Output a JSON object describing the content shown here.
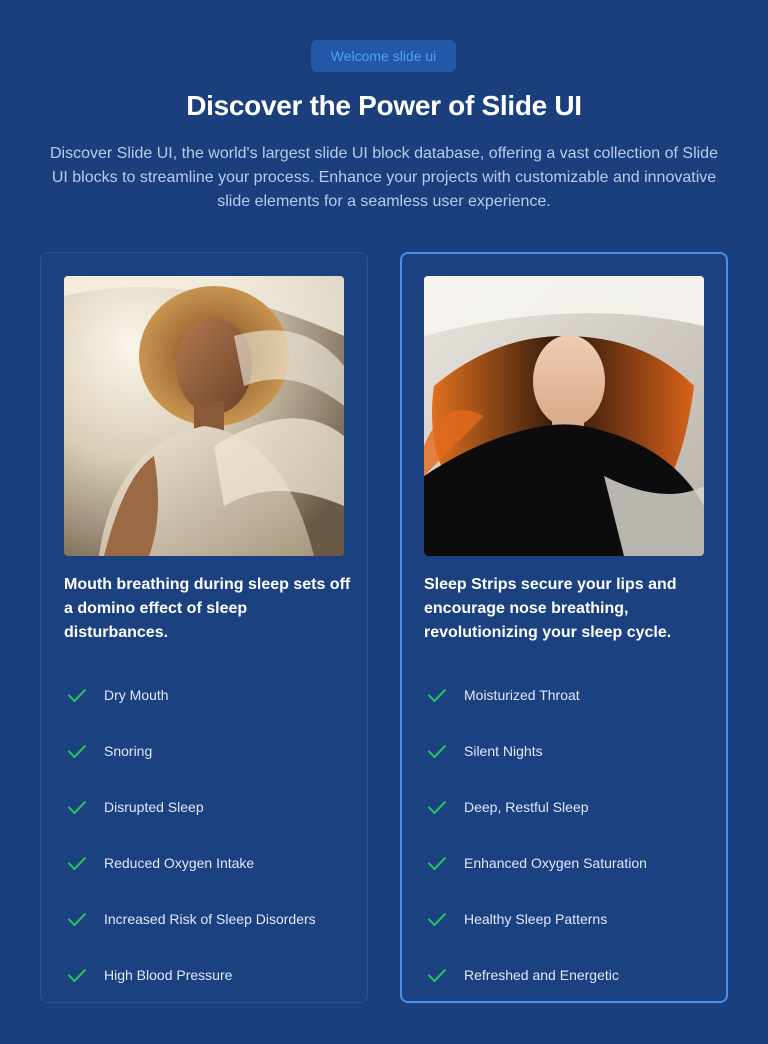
{
  "badge": {
    "label": "Welcome slide ui"
  },
  "hero": {
    "title": "Discover the Power of Slide UI",
    "subtitle": "Discover Slide UI, the world's largest slide UI block database, offering a vast collection of Slide UI blocks to streamline your process. Enhance your projects with customizable and innovative slide elements for a seamless user experience."
  },
  "colors": {
    "background": "#1b3f7c",
    "badge_bg": "#2457a8",
    "badge_text": "#4fa0f5",
    "highlight_border": "#4a8fe8",
    "check": "#22c55e"
  },
  "cards": [
    {
      "image_icon": "portrait-photo",
      "heading": "Mouth breathing during sleep sets off a domino effect of sleep disturbances.",
      "items": [
        {
          "icon": "check-icon",
          "label": "Dry Mouth"
        },
        {
          "icon": "check-icon",
          "label": "Snoring"
        },
        {
          "icon": "check-icon",
          "label": "Disrupted Sleep"
        },
        {
          "icon": "check-icon",
          "label": "Reduced Oxygen Intake"
        },
        {
          "icon": "check-icon",
          "label": "Increased Risk of Sleep Disorders"
        },
        {
          "icon": "check-icon",
          "label": "High Blood Pressure"
        }
      ]
    },
    {
      "image_icon": "portrait-photo",
      "heading": "Sleep Strips secure your lips and encourage nose breathing, revolutionizing your sleep cycle.",
      "items": [
        {
          "icon": "check-icon",
          "label": "Moisturized Throat"
        },
        {
          "icon": "check-icon",
          "label": "Silent Nights"
        },
        {
          "icon": "check-icon",
          "label": "Deep, Restful Sleep"
        },
        {
          "icon": "check-icon",
          "label": "Enhanced Oxygen Saturation"
        },
        {
          "icon": "check-icon",
          "label": "Healthy Sleep Patterns"
        },
        {
          "icon": "check-icon",
          "label": "Refreshed and Energetic"
        }
      ]
    }
  ]
}
